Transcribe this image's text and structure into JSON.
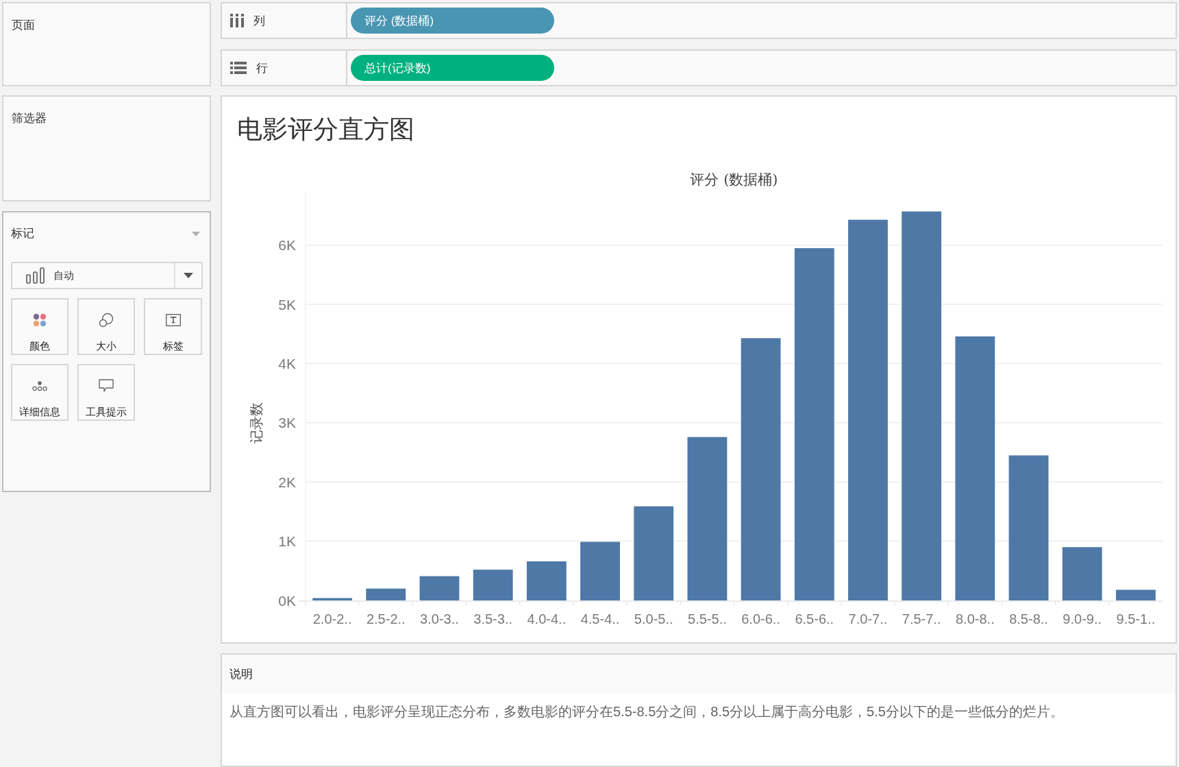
{
  "sidebar": {
    "pages": {
      "title": "页面"
    },
    "filters": {
      "title": "筛选器"
    },
    "marks": {
      "title": "标记",
      "mark_type": "自动",
      "cards": [
        {
          "kind": "color",
          "label": "颜色"
        },
        {
          "kind": "size",
          "label": "大小"
        },
        {
          "kind": "label",
          "label": "标签"
        },
        {
          "kind": "detail",
          "label": "详细信息"
        },
        {
          "kind": "tooltip",
          "label": "工具提示"
        }
      ]
    }
  },
  "shelves": [
    {
      "kind": "columns",
      "label": "列",
      "pills": [
        {
          "text": "评分 (数据桶)",
          "color": "#4996b2"
        }
      ]
    },
    {
      "kind": "rows",
      "label": "行",
      "pills": [
        {
          "text": "总计(记录数)",
          "color": "#00b180"
        }
      ]
    }
  ],
  "chart": {
    "title": "电影评分直方图",
    "chart_data": [
      {
        "type": "bar",
        "xlabel": "评分 (数据桶)",
        "ylabel": "记录数",
        "categories": [
          "2.0-2..",
          "2.5-2..",
          "3.0-3..",
          "3.5-3..",
          "4.0-4..",
          "4.5-4..",
          "5.0-5..",
          "5.5-5..",
          "6.0-6..",
          "6.5-6..",
          "7.0-7..",
          "7.5-7..",
          "8.0-8..",
          "8.5-8..",
          "9.0-9..",
          "9.5-1.."
        ],
        "values": [
          40,
          200,
          410,
          520,
          660,
          990,
          1590,
          2760,
          4430,
          5950,
          6430,
          6570,
          4460,
          2450,
          900,
          180
        ],
        "color": "#4e79a7",
        "ylim": [
          0,
          6900
        ],
        "yticks": [
          {
            "value": 0,
            "label": "0K"
          },
          {
            "value": 1000,
            "label": "1K"
          },
          {
            "value": 2000,
            "label": "2K"
          },
          {
            "value": 3000,
            "label": "3K"
          },
          {
            "value": 4000,
            "label": "4K"
          },
          {
            "value": 5000,
            "label": "5K"
          },
          {
            "value": 6000,
            "label": "6K"
          }
        ],
        "grid": true
      }
    ]
  },
  "caption": {
    "title": "说明",
    "text": "从直方图可以看出，电影评分呈现正态分布，多数电影的评分在5.5-8.5分之间，8.5分以上属于高分电影，5.5分以下的是一些低分的烂片。"
  }
}
